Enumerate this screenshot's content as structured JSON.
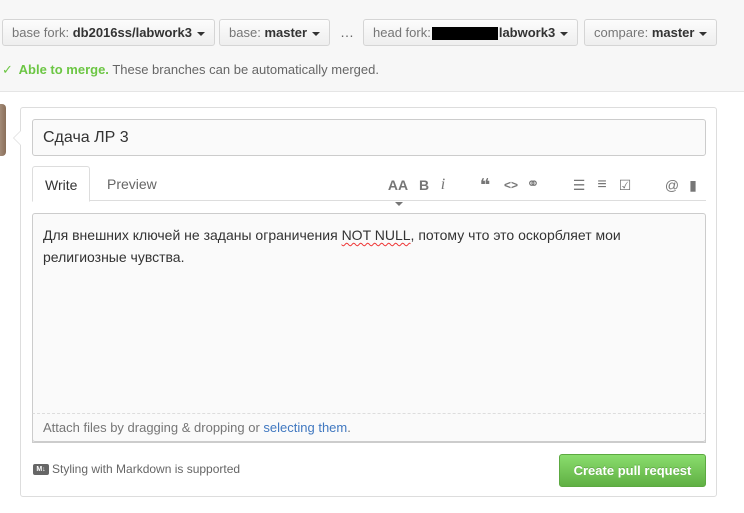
{
  "compare_bar": {
    "base_fork_label": "base fork:",
    "base_fork_value": "db2016ss/labwork3",
    "base_label": "base:",
    "base_value": "master",
    "ellipsis": "…",
    "head_fork_label": "head fork:",
    "head_fork_value": "labwork3",
    "compare_label": "compare:",
    "compare_value": "master"
  },
  "merge_status": {
    "check": "✓",
    "status": "Able to merge.",
    "message": "These branches can be automatically merged."
  },
  "form": {
    "title_value": "Сдача ЛР 3",
    "tabs": [
      "Write",
      "Preview"
    ],
    "toolbar": {
      "text_size": "AA",
      "bold": "B",
      "italic": "i",
      "quote": "❝",
      "code": "<>",
      "link": "⚭",
      "bullet_list": "☰",
      "numbered_list": "≡",
      "task_list": "☑",
      "mention": "@",
      "bookmark": "▮"
    },
    "body_text_before": "Для внешних ключей не заданы ограничения ",
    "body_text_flagged": "NOT NULL",
    "body_text_after": ", потому что это оскорбляет мои религиозные чувства.",
    "attach_text": "Attach files by dragging & dropping or ",
    "attach_link": "selecting them",
    "attach_period": ".",
    "markdown_badge": "M↓",
    "markdown_note": "Styling with Markdown is supported",
    "submit_label": "Create pull request"
  },
  "colors": {
    "accent_green": "#6cc644",
    "button_green": "#60b044",
    "link_blue": "#4078c0"
  }
}
